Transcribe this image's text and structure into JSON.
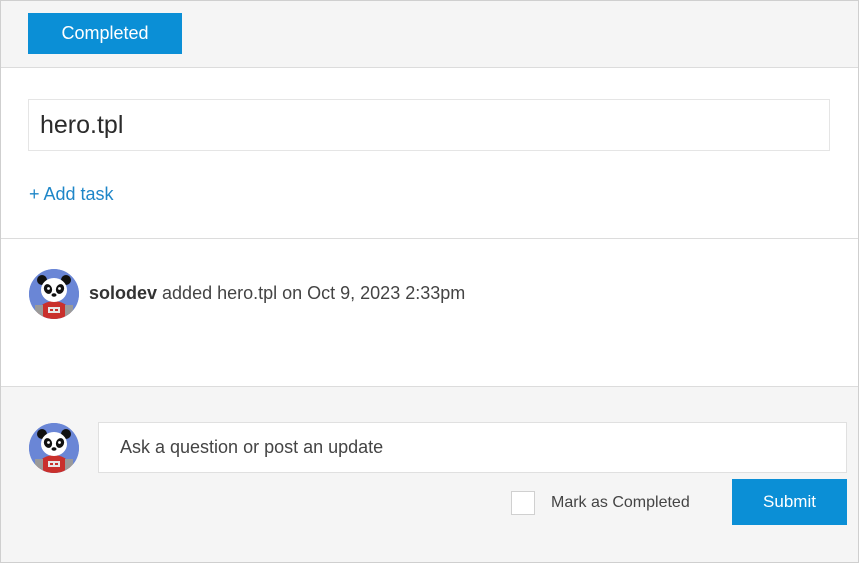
{
  "header": {
    "status_button_label": "Completed"
  },
  "task": {
    "title": "hero.tpl",
    "add_task_label": "+ Add task"
  },
  "activity": {
    "user": "solodev",
    "message": " added hero.tpl on Oct 9, 2023 2:33pm",
    "avatar_icon": "panda-astronaut-avatar"
  },
  "composer": {
    "placeholder": "Ask a question or post an update",
    "value": "",
    "mark_completed_label": "Mark as Completed",
    "mark_completed_checked": false,
    "submit_label": "Submit"
  },
  "colors": {
    "accent": "#0b8fd6",
    "link": "#1e86c8",
    "panel_bg": "#f5f5f5"
  }
}
